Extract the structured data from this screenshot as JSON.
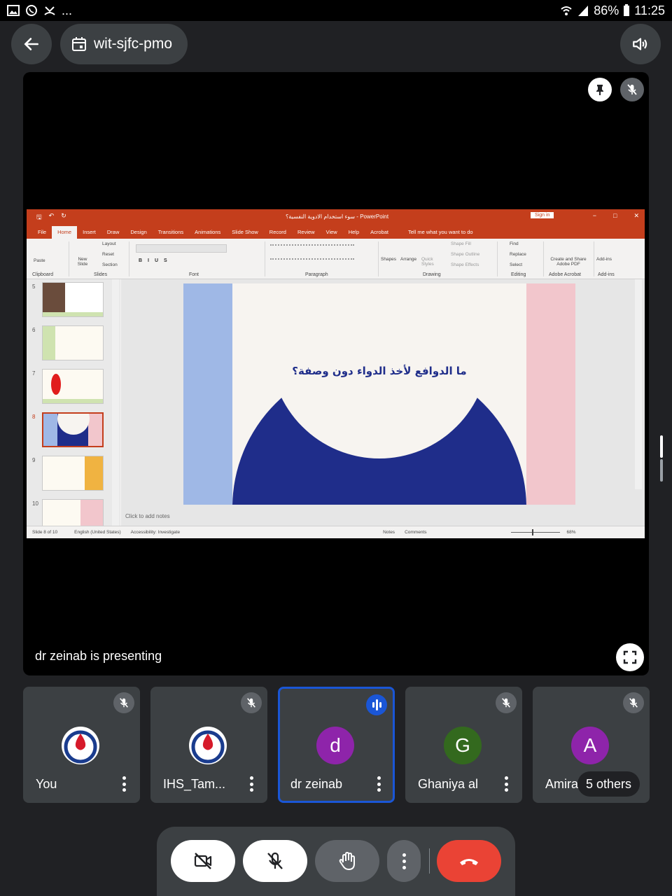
{
  "status_bar": {
    "battery": "86%",
    "time": "11:25",
    "dots": "..."
  },
  "header": {
    "meeting_code": "wit-sjfc-pmo"
  },
  "stage": {
    "presenting_text": "dr zeinab is presenting"
  },
  "powerpoint": {
    "title": "سوء استخدام الادوية النفسية؟  -  PowerPoint",
    "sign_in": "Sign in",
    "tabs": [
      "File",
      "Home",
      "Insert",
      "Draw",
      "Design",
      "Transitions",
      "Animations",
      "Slide Show",
      "Record",
      "Review",
      "View",
      "Help",
      "Acrobat"
    ],
    "tell_me": "Tell me what you want to do",
    "ribbon_groups": [
      "Clipboard",
      "Slides",
      "Font",
      "Paragraph",
      "Drawing",
      "Editing",
      "Adobe Acrobat",
      "Add-ins"
    ],
    "ribbon_items": {
      "paste": "Paste",
      "new_slide": "New Slide",
      "layout": "Layout",
      "reset": "Reset",
      "section": "Section",
      "shapes": "Shapes",
      "arrange": "Arrange",
      "quick_styles": "Quick Styles",
      "shape_fill": "Shape Fill",
      "shape_outline": "Shape Outline",
      "shape_effects": "Shape Effects",
      "find": "Find",
      "replace": "Replace",
      "select": "Select",
      "create_share": "Create and Share Adobe PDF",
      "add_ins": "Add-ins"
    },
    "slide_numbers": [
      "5",
      "6",
      "7",
      "8",
      "9",
      "10"
    ],
    "selected_slide": "8",
    "slide_question": "ما الدوافع لأخذ الدواء دون وصفة؟",
    "notes_placeholder": "Click to add notes",
    "status": {
      "slide_of": "Slide 8 of 10",
      "language": "English (United States)",
      "accessibility": "Accessibility: Investigate",
      "notes": "Notes",
      "comments": "Comments",
      "zoom": "68%"
    }
  },
  "participants": [
    {
      "name": "You",
      "avatar": "logo",
      "muted": true
    },
    {
      "name": "IHS_Tam...",
      "avatar": "logo",
      "muted": true
    },
    {
      "name": "dr zeinab",
      "avatar": "d",
      "color": "#8e24aa",
      "speaking": true
    },
    {
      "name": "Ghaniya al",
      "avatar": "G",
      "color": "#33691e",
      "muted": true
    },
    {
      "name": "Amira",
      "avatar": "A",
      "color": "#8e24aa",
      "muted": true,
      "others": "5 others"
    }
  ],
  "colors": {
    "end_call": "#ea4335",
    "speaking_border": "#1a56d6",
    "ppt_accent": "#c43e1c",
    "slide_navy": "#1f2d8a"
  }
}
